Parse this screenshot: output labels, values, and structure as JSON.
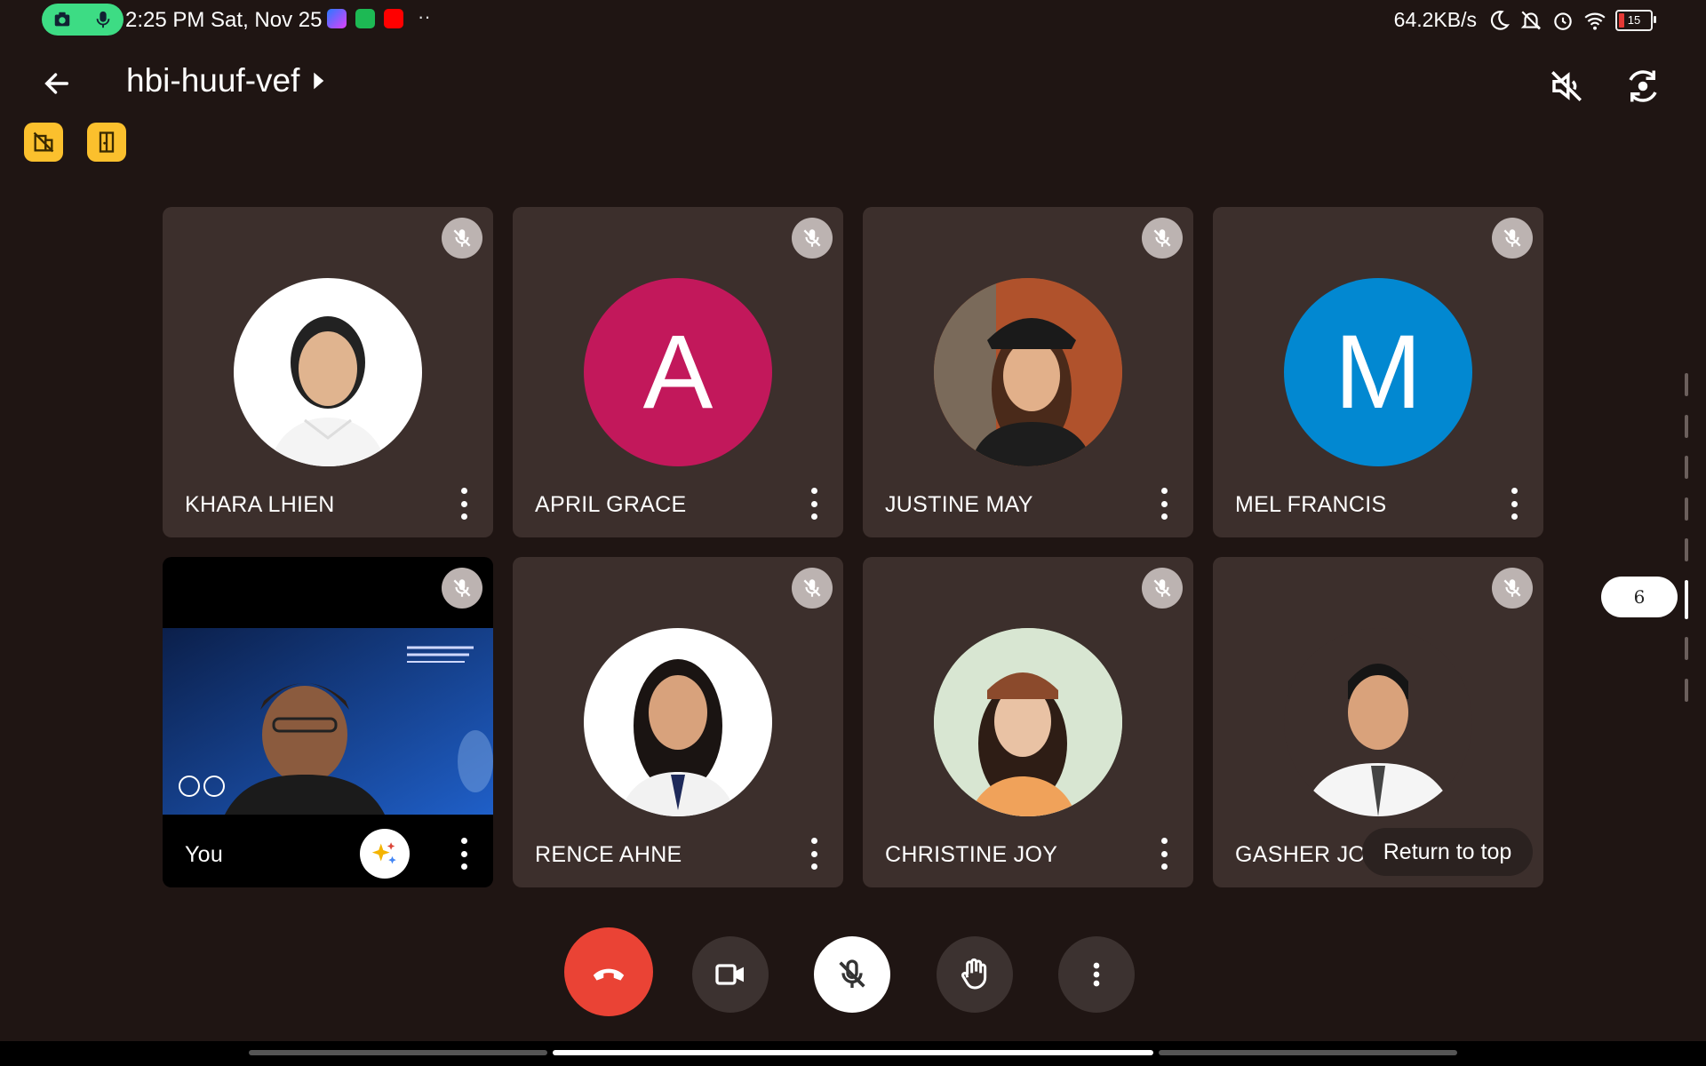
{
  "status_bar": {
    "time_date": "2:25 PM Sat, Nov 25",
    "network_speed": "64.2KB/s",
    "battery_level": "15",
    "icons": [
      "camera-icon",
      "microphone-icon",
      "messenger-icon",
      "shield-app-icon",
      "youtube-icon",
      "moon-icon",
      "bell-off-icon",
      "alarm-icon",
      "wifi-icon",
      "battery-icon"
    ]
  },
  "header": {
    "meeting_code": "hbi-huuf-vef",
    "icons": [
      "back-arrow-icon",
      "chevron-right-icon",
      "speaker-off-icon",
      "switch-camera-icon"
    ]
  },
  "chips": [
    "no-building-icon",
    "door-icon"
  ],
  "participants": [
    {
      "name": "KHARA LHIEN",
      "avatar": "photo",
      "muted": true
    },
    {
      "name": "APRIL GRACE",
      "avatar_letter": "A",
      "avatar_color": "#c2185b",
      "muted": true
    },
    {
      "name": "JUSTINE MAY",
      "avatar": "photo",
      "muted": true
    },
    {
      "name": "MEL FRANCIS",
      "avatar_letter": "M",
      "avatar_color": "#0288d1",
      "muted": true
    },
    {
      "name": "You",
      "avatar": "video",
      "muted": true
    },
    {
      "name": "RENCE AHNE",
      "avatar": "photo",
      "muted": true
    },
    {
      "name": "CHRISTINE JOY",
      "avatar": "photo",
      "muted": true
    },
    {
      "name": "GASHER JOH",
      "avatar": "photo",
      "muted": true
    }
  ],
  "return_to_top": "Return to top",
  "page_indicator": "6",
  "controls": [
    "end-call-icon",
    "video-camera-icon",
    "mic-off-icon",
    "raise-hand-icon",
    "more-vert-icon"
  ],
  "colors": {
    "background": "#1f1513",
    "tile": "#3c2f2c",
    "end_call": "#ea4335",
    "chip": "#fbc02d",
    "rec_pill": "#3ddc84"
  }
}
